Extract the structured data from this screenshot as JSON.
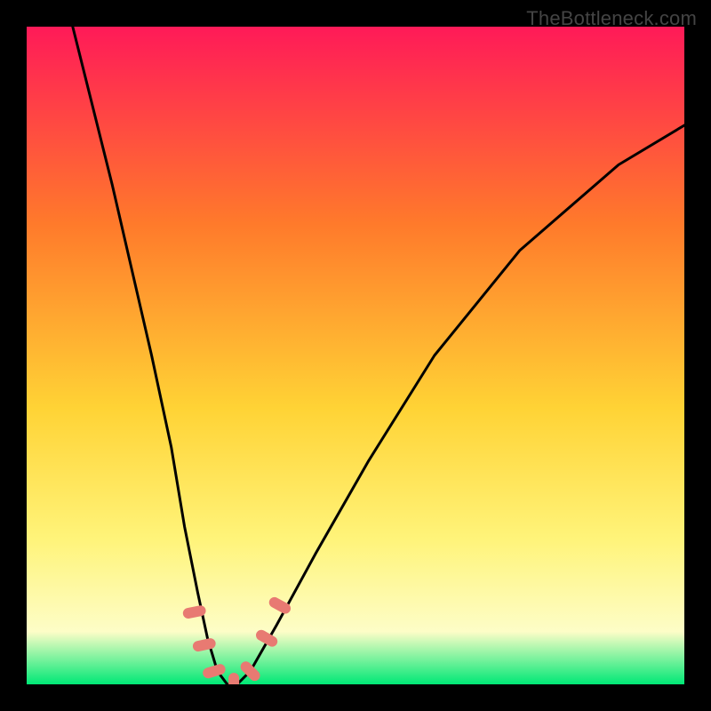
{
  "watermark": "TheBottleneck.com",
  "chart_data": {
    "type": "line",
    "title": "",
    "xlabel": "",
    "ylabel": "",
    "xlim": [
      0,
      100
    ],
    "ylim": [
      0,
      100
    ],
    "background_gradient": {
      "top": "#ff1a58",
      "mid_upper": "#ff7a2b",
      "mid": "#ffd335",
      "mid_lower": "#fff47a",
      "pale": "#fdfdc7",
      "green": "#00e876"
    },
    "series": [
      {
        "name": "bottleneck-curve",
        "x": [
          7,
          10,
          13,
          16,
          19,
          22,
          24,
          26,
          27.5,
          29,
          30.5,
          32,
          34,
          38,
          44,
          52,
          62,
          75,
          90,
          100
        ],
        "y_pct": [
          100,
          88,
          76,
          63,
          50,
          36,
          24,
          14,
          7,
          2,
          0,
          0,
          2,
          9,
          20,
          34,
          50,
          66,
          79,
          85
        ]
      }
    ],
    "markers": [
      {
        "name": "marker-1",
        "x": 25.5,
        "y_pct": 11
      },
      {
        "name": "marker-2",
        "x": 27.0,
        "y_pct": 6
      },
      {
        "name": "marker-3",
        "x": 28.5,
        "y_pct": 2
      },
      {
        "name": "marker-4",
        "x": 31.5,
        "y_pct": 0
      },
      {
        "name": "marker-5",
        "x": 34.0,
        "y_pct": 2
      },
      {
        "name": "marker-6",
        "x": 36.5,
        "y_pct": 7
      },
      {
        "name": "marker-7",
        "x": 38.5,
        "y_pct": 12
      }
    ]
  }
}
